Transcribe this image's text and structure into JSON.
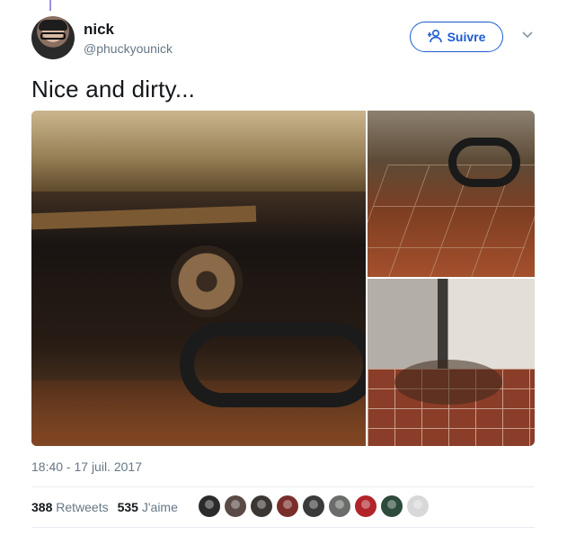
{
  "user": {
    "display_name": "nick",
    "handle": "@phuckyounick"
  },
  "follow_button": {
    "label": "Suivre",
    "icon": "add-person-icon",
    "color": "#1b5bd1"
  },
  "menu_caret": {
    "icon": "chevron-down-icon"
  },
  "tweet": {
    "text": "Nice and dirty...",
    "timestamp": "18:40 - 17 juil. 2017",
    "photos_count": 3
  },
  "stats": {
    "retweets_count": "388",
    "retweets_label": "Retweets",
    "likes_count": "535",
    "likes_label": "J'aime"
  },
  "likers": [
    {
      "color": "#2b2b2b"
    },
    {
      "color": "#5a4a45"
    },
    {
      "color": "#3b3632"
    },
    {
      "color": "#7a2e2a"
    },
    {
      "color": "#3a3a3a"
    },
    {
      "color": "#6a6d6a"
    },
    {
      "color": "#b0242a"
    },
    {
      "color": "#2d4a3a"
    },
    {
      "color": "#d8d8d8"
    }
  ]
}
